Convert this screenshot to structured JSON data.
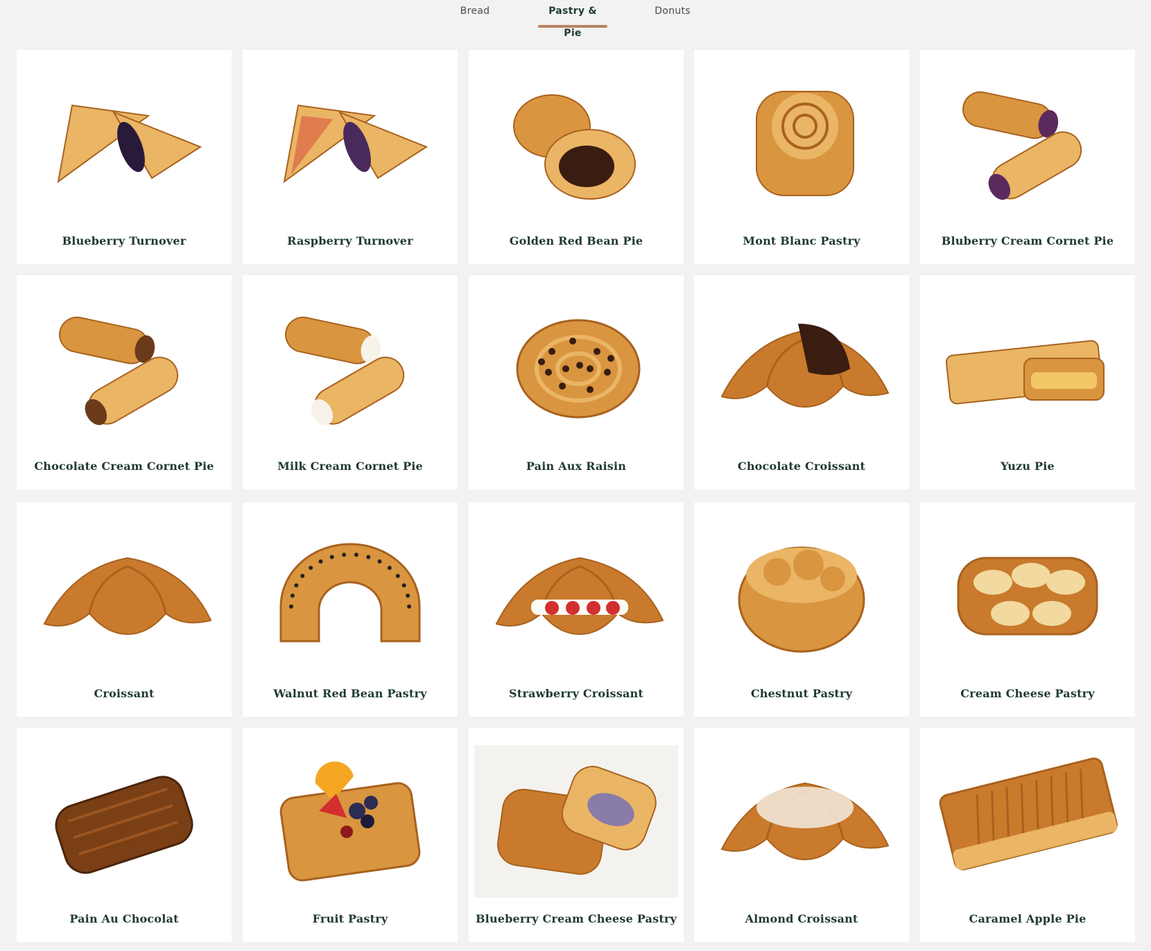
{
  "tabs": [
    {
      "label": "Bread",
      "active": false
    },
    {
      "label": "Pastry & Pie",
      "active": true
    },
    {
      "label": "Donuts",
      "active": false
    }
  ],
  "colors": {
    "page_bg": "#f2f2f2",
    "card_bg": "#ffffff",
    "title_text": "#1f3a2e",
    "tab_underline": "#b9845e"
  },
  "products": [
    {
      "name": "Blueberry Turnover",
      "image": "turnover-icon"
    },
    {
      "name": "Raspberry Turnover",
      "image": "turnover-icon"
    },
    {
      "name": "Golden Red Bean Pie",
      "image": "bean-pie-icon"
    },
    {
      "name": "Mont Blanc Pastry",
      "image": "spiral-pastry-icon"
    },
    {
      "name": "Bluberry Cream Cornet Pie",
      "image": "cornet-icon"
    },
    {
      "name": "Chocolate Cream Cornet Pie",
      "image": "cornet-icon"
    },
    {
      "name": "Milk Cream Cornet Pie",
      "image": "cornet-icon"
    },
    {
      "name": "Pain Aux Raisin",
      "image": "raisin-swirl-icon"
    },
    {
      "name": "Chocolate Croissant",
      "image": "croissant-icon"
    },
    {
      "name": "Yuzu Pie",
      "image": "pie-bar-icon"
    },
    {
      "name": "Croissant",
      "image": "croissant-icon"
    },
    {
      "name": "Walnut Red Bean Pastry",
      "image": "arch-pastry-icon"
    },
    {
      "name": "Strawberry Croissant",
      "image": "croissant-icon"
    },
    {
      "name": "Chestnut Pastry",
      "image": "round-pastry-icon"
    },
    {
      "name": "Cream Cheese Pastry",
      "image": "cheese-pastry-icon"
    },
    {
      "name": "Pain Au Chocolat",
      "image": "pain-chocolat-icon"
    },
    {
      "name": "Fruit Pastry",
      "image": "fruit-danish-icon"
    },
    {
      "name": "Blueberry Cream Cheese Pastry",
      "image": "filled-pastry-icon"
    },
    {
      "name": "Almond Croissant",
      "image": "croissant-icon"
    },
    {
      "name": "Caramel Apple Pie",
      "image": "apple-pie-icon"
    }
  ]
}
